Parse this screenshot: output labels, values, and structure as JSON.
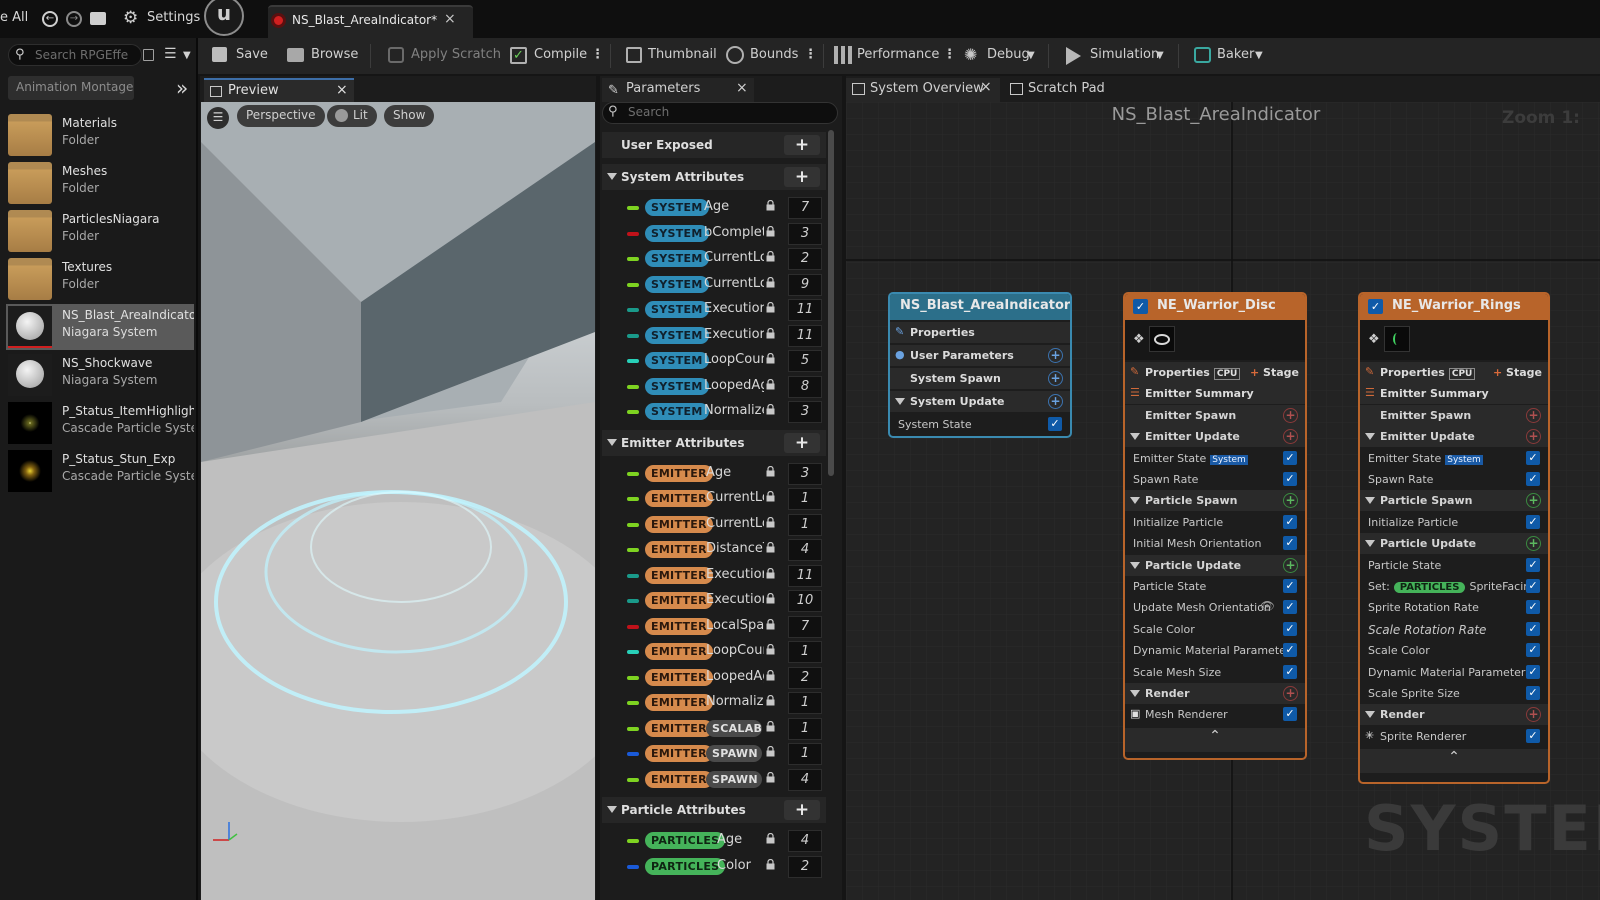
{
  "top": {
    "browse_all": "e All",
    "settings": "Settings",
    "asset_tab": "NS_Blast_AreaIndicator*"
  },
  "toolbar": {
    "save": "Save",
    "browse": "Browse",
    "apply_scratch": "Apply Scratch",
    "compile": "Compile",
    "thumbnail": "Thumbnail",
    "bounds": "Bounds",
    "performance": "Performance",
    "debug": "Debug",
    "simulation": "Simulation",
    "baker": "Baker"
  },
  "content_browser": {
    "search_placeholder": "Search RPGEffe",
    "filter_chip": "Animation Montage",
    "items": [
      {
        "name": "Materials",
        "type": "Folder"
      },
      {
        "name": "Meshes",
        "type": "Folder"
      },
      {
        "name": "ParticlesNiagara",
        "type": "Folder"
      },
      {
        "name": "Textures",
        "type": "Folder"
      },
      {
        "name": "NS_Blast_AreaIndicator",
        "type": "Niagara System"
      },
      {
        "name": "NS_Shockwave",
        "type": "Niagara System"
      },
      {
        "name": "P_Status_ItemHighlight_E",
        "type": "Cascade Particle Syster"
      },
      {
        "name": "P_Status_Stun_Exp",
        "type": "Cascade Particle Syster"
      }
    ]
  },
  "preview": {
    "tab": "Preview",
    "perspective": "Perspective",
    "lit": "Lit",
    "show": "Show"
  },
  "parameters": {
    "tab": "Parameters",
    "search_placeholder": "Search",
    "user_exposed": "User Exposed",
    "system_attributes": "System Attributes",
    "emitter_attributes": "Emitter Attributes",
    "particle_attributes": "Particle Attributes",
    "system_rows": [
      {
        "ns": "SYSTEM",
        "name": "Age",
        "value": "7",
        "dash": "#7ed321"
      },
      {
        "ns": "SYSTEM",
        "name": "bComplete",
        "value": "3",
        "dash": "#c0121a"
      },
      {
        "ns": "SYSTEM",
        "name": "CurrentLo",
        "value": "2",
        "dash": "#7ed321"
      },
      {
        "ns": "SYSTEM",
        "name": "CurrentLo",
        "value": "9",
        "dash": "#7ed321"
      },
      {
        "ns": "SYSTEM",
        "name": "Executior",
        "value": "11",
        "dash": "#1a9a8a"
      },
      {
        "ns": "SYSTEM",
        "name": "Executior",
        "value": "11",
        "dash": "#1a9a8a"
      },
      {
        "ns": "SYSTEM",
        "name": "LoopCount",
        "value": "5",
        "dash": "#28d0b8"
      },
      {
        "ns": "SYSTEM",
        "name": "LoopedAg",
        "value": "8",
        "dash": "#7ed321"
      },
      {
        "ns": "SYSTEM",
        "name": "Normalize",
        "value": "3",
        "dash": "#7ed321"
      }
    ],
    "emitter_rows": [
      {
        "ns": "EMITTER",
        "name": "Age",
        "value": "3",
        "dash": "#7ed321"
      },
      {
        "ns": "EMITTER",
        "name": "CurrentLo",
        "value": "1",
        "dash": "#7ed321"
      },
      {
        "ns": "EMITTER",
        "name": "CurrentLo",
        "value": "1",
        "dash": "#7ed321"
      },
      {
        "ns": "EMITTER",
        "name": "DistanceT",
        "value": "4",
        "dash": "#7ed321"
      },
      {
        "ns": "EMITTER",
        "name": "Executior",
        "value": "11",
        "dash": "#1a9a8a"
      },
      {
        "ns": "EMITTER",
        "name": "Executior",
        "value": "10",
        "dash": "#1a9a8a"
      },
      {
        "ns": "EMITTER",
        "name": "LocalSpac",
        "value": "7",
        "dash": "#c0121a"
      },
      {
        "ns": "EMITTER",
        "name": "LoopCoun",
        "value": "1",
        "dash": "#28d0b8"
      },
      {
        "ns": "EMITTER",
        "name": "LoopedAg",
        "value": "2",
        "dash": "#7ed321"
      },
      {
        "ns": "EMITTER",
        "name": "Normalize",
        "value": "1",
        "dash": "#7ed321"
      },
      {
        "ns": "EMITTER",
        "name": "SCALABILI",
        "value": "1",
        "dash": "#7ed321",
        "pill2": true
      },
      {
        "ns": "EMITTER",
        "name": "SPAWN RA",
        "value": "1",
        "dash": "#1a5ad8",
        "pill2": true
      },
      {
        "ns": "EMITTER",
        "name": "SPAWN RA",
        "value": "4",
        "dash": "#7ed321",
        "pill2": true
      }
    ],
    "particle_rows": [
      {
        "ns": "PARTICLES",
        "name": "Age",
        "value": "4",
        "dash": "#7ed321"
      },
      {
        "ns": "PARTICLES",
        "name": "Color",
        "value": "2",
        "dash": "#1a5ad8"
      }
    ]
  },
  "graph": {
    "tab_overview": "System Overview",
    "tab_scratch": "Scratch Pad",
    "title": "NS_Blast_AreaIndicator",
    "zoom": "Zoom 1:",
    "watermark": "SYSTEM",
    "system_node": {
      "title": "NS_Blast_AreaIndicator",
      "properties": "Properties",
      "user_parameters": "User Parameters",
      "system_spawn": "System Spawn",
      "system_update": "System Update",
      "system_state": "System State"
    },
    "disc_node": {
      "title": "NE_Warrior_Disc",
      "properties": "Properties",
      "cpu": "CPU",
      "stage": "Stage",
      "emitter_summary": "Emitter Summary",
      "emitter_spawn": "Emitter Spawn",
      "emitter_update": "Emitter Update",
      "emitter_state": "Emitter State",
      "system_tag": "System",
      "spawn_rate": "Spawn Rate",
      "particle_spawn": "Particle Spawn",
      "initialize_particle": "Initialize Particle",
      "initial_mesh_orientation": "Initial Mesh Orientation",
      "particle_update": "Particle Update",
      "particle_state": "Particle State",
      "update_mesh_orientation": "Update Mesh Orientation",
      "scale_color": "Scale Color",
      "dynamic_material_parameters": "Dynamic Material Parameters",
      "scale_mesh_size": "Scale Mesh Size",
      "render": "Render",
      "mesh_renderer": "Mesh Renderer"
    },
    "rings_node": {
      "title": "NE_Warrior_Rings",
      "properties": "Properties",
      "cpu": "CPU",
      "stage": "Stage",
      "emitter_summary": "Emitter Summary",
      "emitter_spawn": "Emitter Spawn",
      "emitter_update": "Emitter Update",
      "emitter_state": "Emitter State",
      "system_tag": "System",
      "spawn_rate": "Spawn Rate",
      "particle_spawn": "Particle Spawn",
      "initialize_particle": "Initialize Particle",
      "particle_update": "Particle Update",
      "particle_state": "Particle State",
      "set_label": "Set:",
      "particles_tag": "PARTICLES",
      "sprite_facing": "SpriteFacing",
      "sprite_rotation_rate": "Sprite Rotation Rate",
      "scale_rotation_rate": "Scale Rotation Rate",
      "scale_color": "Scale Color",
      "dynamic_material_parameters": "Dynamic Material Parameters",
      "scale_sprite_size": "Scale Sprite Size",
      "render": "Render",
      "sprite_renderer": "Sprite Renderer"
    }
  },
  "colors": {
    "system_pill": "#2f8db8",
    "emitter_pill": "#d68a4c",
    "particles_pill": "#45b35a",
    "node_header_system": "#2c6f8a",
    "node_header_emitter": "#b8642a"
  }
}
